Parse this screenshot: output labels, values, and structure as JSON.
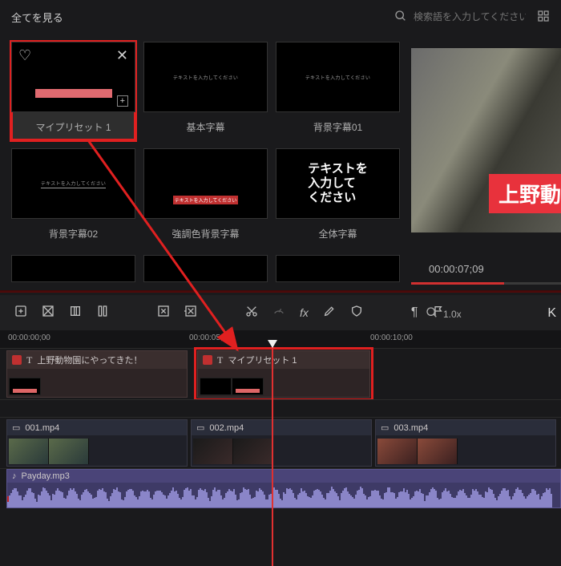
{
  "topbar": {
    "view_all": "全てを見る",
    "search_placeholder": "検索語を入力してください。"
  },
  "presets": [
    {
      "label": "マイプリセット 1",
      "selected": true
    },
    {
      "label": "基本字幕"
    },
    {
      "label": "背景字幕01"
    },
    {
      "label": "背景字幕02"
    },
    {
      "label": "強調色背景字幕"
    },
    {
      "label": "全体字幕",
      "big_text": "テキストを\n入力して\nください"
    }
  ],
  "preview": {
    "overlay_text": "上野動",
    "timecode": "00:00:07;09",
    "zoom": "1.0x",
    "k_label": "K"
  },
  "ruler": {
    "tc0": "00:00:00;00",
    "tc5": "00:00:05;00",
    "tc10": "00:00:10;00"
  },
  "text_track": {
    "clip1_title": "上野動物園にやってきた！",
    "clip2_title": "マイプリセット 1"
  },
  "video_track": {
    "c1": "001.mp4",
    "c2": "002.mp4",
    "c3": "003.mp4"
  },
  "audio_track": {
    "clip": "Payday.mp3",
    "fx": "fx"
  }
}
